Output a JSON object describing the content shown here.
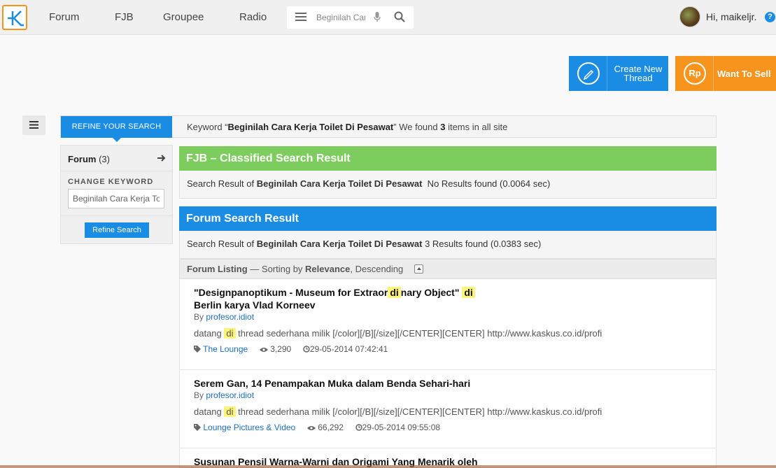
{
  "nav": {
    "links": [
      "Forum",
      "FJB",
      "Groupee",
      "Radio"
    ],
    "search_value": "Beginilah Cara Kerja Toilet Di Pesawat",
    "greeting": "Hi, maikeljr.",
    "help": "?"
  },
  "actions": {
    "create_thread": "Create New Thread",
    "create_line1": "Create New",
    "create_line2": "Thread",
    "sell_icon": "Rp",
    "want_to_sell": "Want To Sell"
  },
  "refine": {
    "tab_label": "REFINE YOUR SEARCH",
    "keyword_prefix": "Keyword “",
    "keyword": "Beginilah Cara Kerja Toilet Di Pesawat",
    "keyword_mid": "” We found ",
    "count": "3",
    "keyword_suffix": " items in all site"
  },
  "sidebar": {
    "forum_label": "Forum",
    "forum_count": "(3)",
    "change_keyword": "CHANGE KEYWORD",
    "keyword_value": "Beginilah Cara Kerja Toilet Di Pesawat",
    "refine_button": "Refine Search"
  },
  "fjb": {
    "title": "FJB – Classified Search Result",
    "prefix": "Search Result of ",
    "keyword": "Beginilah Cara Kerja Toilet Di Pesawat",
    "status": "  No Results found (0.0064 sec)"
  },
  "forum": {
    "title": "Forum Search Result",
    "prefix": "Search Result of ",
    "keyword": "Beginilah Cara Kerja Toilet Di Pesawat",
    "status": " 3 Results found (0.0383 sec)",
    "listing_label": "Forum Listing",
    "sorting_text": " — Sorting by ",
    "sort_field": "Relevance",
    "sort_order": ", Descending"
  },
  "results": [
    {
      "title_a": "\"Designpanoptikum - Museum for Extraor",
      "title_hl": "di",
      "title_b": "nary Object\" ",
      "title_hl2": "di",
      "title_line2": "Berlin karya Vlad Korneev",
      "by": "By ",
      "author": "profesor.idiot",
      "snippet_a": "datang ",
      "snippet_hl": "di",
      "snippet_b": " thread sederhana milik [/color][/B][/size][/CENTER][CENTER] http://www.kaskus.co.id/profi",
      "category": "The Lounge",
      "views": "3,290",
      "date": "29-05-2014 07:42:41"
    },
    {
      "title": "Serem Gan, 14 Penampakan Muka dalam Benda Sehari-hari",
      "by": "By ",
      "author": "profesor.idiot",
      "snippet_a": "datang ",
      "snippet_hl": "di",
      "snippet_b": " thread sederhana milik [/color][/B][/size][/CENTER][CENTER] http://www.kaskus.co.id/profi",
      "category": "Lounge Pictures & Video",
      "views": "66,292",
      "date": "29-05-2014 09:55:08"
    },
    {
      "title": "Susunan Pensil Warna-Warni dan Origami Yang Menarik oleh"
    }
  ],
  "colors": {
    "brand_blue": "#1b8ce3",
    "brand_orange": "#f7941e",
    "fjb_green": "#7ccd5e",
    "highlight": "#fdf57a"
  }
}
